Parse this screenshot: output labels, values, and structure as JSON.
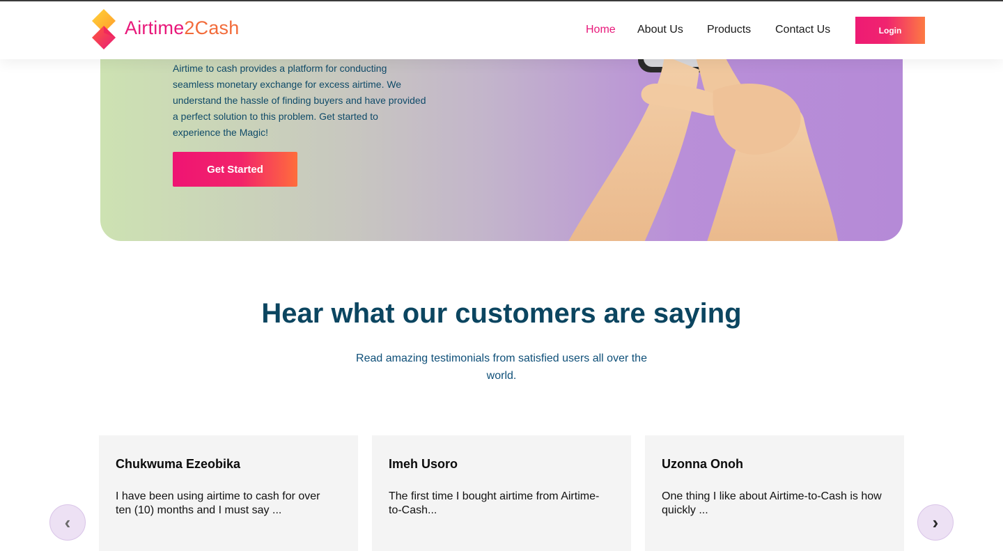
{
  "header": {
    "brand_part1": "Airtime",
    "brand_part2": "2Cash",
    "nav": [
      "Home",
      "About Us",
      "Products",
      "Contact Us"
    ],
    "active_nav": "Home",
    "login_label": "Login"
  },
  "hero": {
    "description": "Airtime to cash provides a platform for conducting seamless monetary exchange for excess airtime. We understand the hassle of finding buyers and have provided a perfect solution to this problem. Get started to experience the Magic!",
    "cta_label": "Get Started"
  },
  "testimonials": {
    "title": "Hear what our customers are saying",
    "subtitle": "Read amazing testimonials from satisfied users all over the world.",
    "cards": [
      {
        "name": "Chukwuma Ezeobika",
        "text": "I have been using airtime to cash for over ten (10) months and I must say ..."
      },
      {
        "name": "Imeh Usoro",
        "text": "The first time I bought airtime from Airtime-to-Cash..."
      },
      {
        "name": "Uzonna Onoh",
        "text": "One thing I like about Airtime-to-Cash is how quickly ..."
      }
    ],
    "prev_icon": "‹",
    "next_icon": "›"
  },
  "colors": {
    "accent": "#e8187a",
    "accent_orange": "#f26b3a",
    "heading": "#0b4560"
  },
  "icons": {
    "logo": "airtime2cash-logo",
    "prev": "chevron-left-icon",
    "next": "chevron-right-icon"
  }
}
